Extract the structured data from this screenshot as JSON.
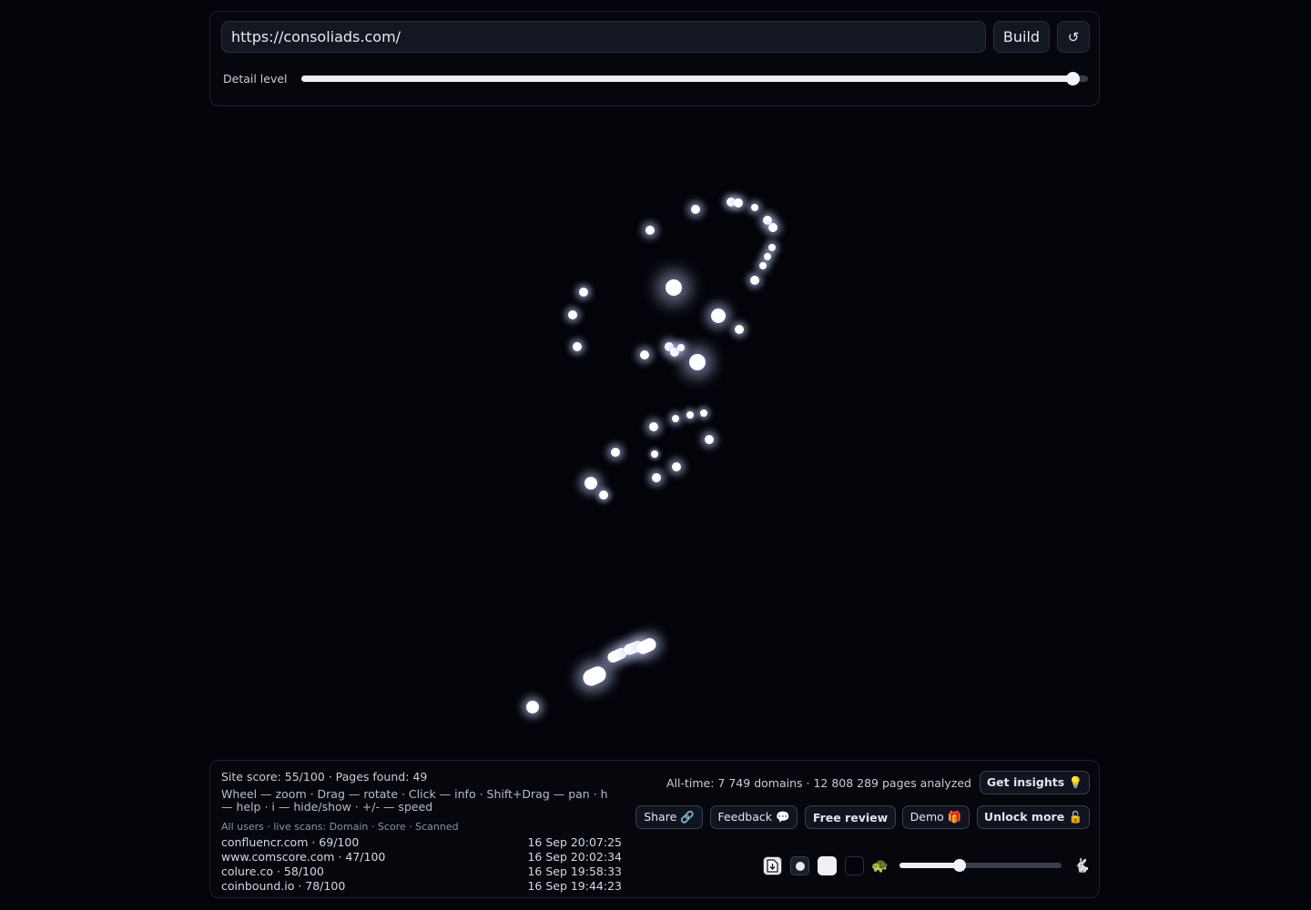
{
  "toolbar": {
    "url_value": "https://consoliads.com/",
    "build_label": "Build",
    "reset_icon": "↺",
    "detail_label": "Detail level",
    "detail_level_fraction": 0.98
  },
  "stats": {
    "site_score_line": "Site score: 55/100 · Pages found: 49",
    "help_line": "Wheel — zoom · Drag — rotate · Click — info · Shift+Drag — pan · h — help · i — hide/show · +/- — speed",
    "scans_header": "All users · live scans: Domain · Score · Scanned",
    "scans": [
      {
        "domain": "confluencr.com · 69/100",
        "time": "16 Sep 20:07:25"
      },
      {
        "domain": "www.comscore.com · 47/100",
        "time": "16 Sep 20:02:34"
      },
      {
        "domain": "colure.co · 58/100",
        "time": "16 Sep 19:58:33"
      },
      {
        "domain": "coinbound.io · 78/100",
        "time": "16 Sep 19:44:23"
      }
    ],
    "alltime_line": "All-time: 7 749 domains · 12 808 289 pages analyzed"
  },
  "actions": {
    "insights": "Get insights 💡",
    "share": "Share 🔗",
    "feedback": "Feedback 💬",
    "free_review": "Free review",
    "demo": "Demo 🎁",
    "unlock": "Unlock more 🔓"
  },
  "controls": {
    "slow_icon": "🐢",
    "fast_icon": "🐇",
    "speed_fraction": 0.37
  }
}
